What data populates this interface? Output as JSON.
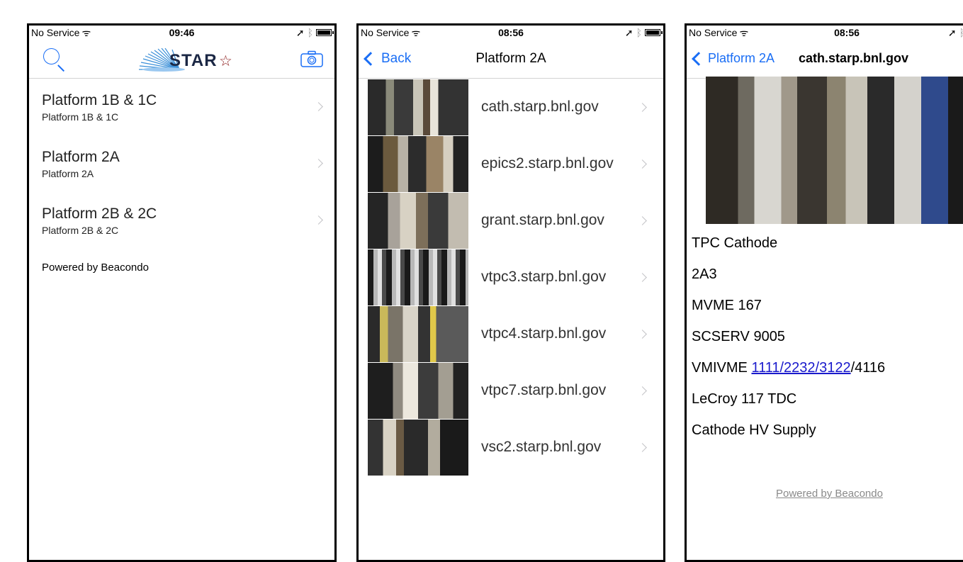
{
  "screens": [
    {
      "status": {
        "carrier": "No Service",
        "time": "09:46"
      },
      "nav": {
        "logo_text": "STAR",
        "logo_star": "☆"
      },
      "items": [
        {
          "title": "Platform 1B & 1C",
          "subtitle": "Platform 1B & 1C"
        },
        {
          "title": "Platform 2A",
          "subtitle": "Platform 2A"
        },
        {
          "title": "Platform 2B & 2C",
          "subtitle": "Platform 2B & 2C"
        }
      ],
      "footer": "Powered by Beacondo"
    },
    {
      "status": {
        "carrier": "No Service",
        "time": "08:56"
      },
      "nav": {
        "back_label": "Back",
        "title": "Platform 2A"
      },
      "items": [
        {
          "label": "cath.starp.bnl.gov"
        },
        {
          "label": "epics2.starp.bnl.gov"
        },
        {
          "label": "grant.starp.bnl.gov"
        },
        {
          "label": "vtpc3.starp.bnl.gov"
        },
        {
          "label": "vtpc4.starp.bnl.gov"
        },
        {
          "label": "vtpc7.starp.bnl.gov"
        },
        {
          "label": "vsc2.starp.bnl.gov"
        }
      ]
    },
    {
      "status": {
        "carrier": "No Service",
        "time": "08:56"
      },
      "nav": {
        "back_label": "Platform 2A",
        "title": "cath.starp.bnl.gov"
      },
      "lines": [
        "TPC Cathode",
        "2A3",
        "MVME 167",
        "SCSERV 9005",
        "",
        "LeCroy 117 TDC",
        "Cathode HV Supply"
      ],
      "vmivme": {
        "prefix": "VMIVME ",
        "link": "1111/2232/3122",
        "suffix": "/4116"
      },
      "footer": "Powered by Beacondo"
    }
  ],
  "colors": {
    "accent": "#1a6ef5",
    "link": "#1a1acc",
    "separator": "#d2d2d2",
    "logo_star": "#8b1a1a"
  },
  "icons": [
    "search-icon",
    "camera-icon",
    "chevron-left-icon",
    "chevron-right-icon",
    "wifi-icon",
    "location-icon",
    "bluetooth-icon",
    "battery-icon"
  ]
}
